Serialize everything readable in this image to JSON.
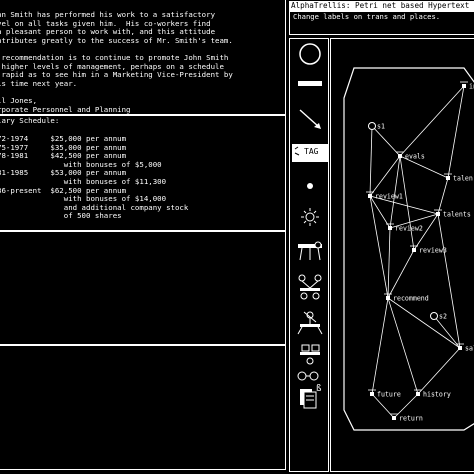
{
  "left": {
    "para": [
      "nn Smith has performed his work to a satisfactory",
      "vel on all tasks given him.  His co-workers find",
      "a pleasant person to work with, and this attitude",
      "ntributes greatly to the success of Mr. Smith's team.",
      "",
      " recommendation is to continue to promote John Smith",
      " higher levels of management, perhaps on a schedule",
      " rapid as to see him in a Marketing Vice-President by",
      "is time next year.",
      "",
      "ll Jones,",
      "rporate Personnel and Planning",
      "gaLith Corp."
    ],
    "schedule_title": "lary Schedule:",
    "schedule": [
      "72-1974     $25,000 per annum",
      "75-1977     $35,000 per annum",
      "78-1981     $42,500 per annum",
      "               with bonuses of $5,000",
      "81-1985     $53,000 per annum",
      "               with bonuses of $11,300",
      "86-present  $62,500 per annum",
      "               with bonuses of $14,000",
      "               and additional company stock",
      "               of 500 shares"
    ]
  },
  "right": {
    "title": "AlphaTrellis: Petri net based Hypertext t",
    "status": "Change labels on trans and places.",
    "tools": [
      {
        "icon": "circle-icon"
      },
      {
        "icon": "bar-icon"
      },
      {
        "icon": "arrow-icon"
      },
      {
        "icon": "tag-icon",
        "label": "TAG"
      },
      {
        "icon": "dot-icon"
      },
      {
        "icon": "sun-icon"
      },
      {
        "icon": "fork-icon"
      },
      {
        "icon": "join-icon"
      },
      {
        "icon": "branch-icon"
      },
      {
        "icon": "merge-icon"
      },
      {
        "icon": "split-icon"
      },
      {
        "icon": "copy-icon"
      },
      {
        "icon": "text-icon",
        "label": "ß"
      }
    ],
    "net": {
      "nodes": [
        {
          "id": "s1",
          "label": "s1"
        },
        {
          "id": "evals",
          "label": "evals"
        },
        {
          "id": "review1",
          "label": "review1"
        },
        {
          "id": "review2",
          "label": "review2"
        },
        {
          "id": "review3",
          "label": "review3"
        },
        {
          "id": "recommend",
          "label": "recommend"
        },
        {
          "id": "talents",
          "label": "talents"
        },
        {
          "id": "talen",
          "label": "talen"
        },
        {
          "id": "in",
          "label": "in"
        },
        {
          "id": "s2",
          "label": "s2"
        },
        {
          "id": "sala",
          "label": "sala"
        },
        {
          "id": "future",
          "label": "future"
        },
        {
          "id": "history",
          "label": "history"
        },
        {
          "id": "return",
          "label": "return"
        }
      ]
    }
  }
}
